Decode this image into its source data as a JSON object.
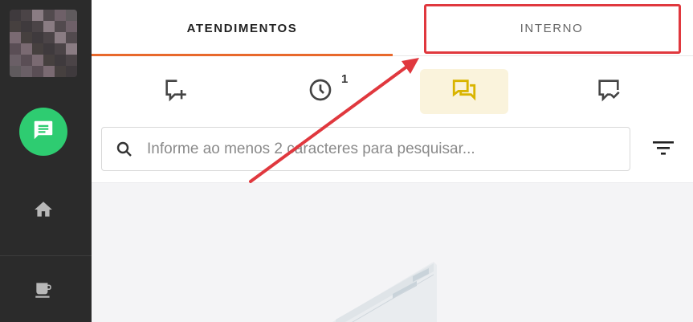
{
  "sidebar": {
    "items": [
      {
        "icon": "chat-icon",
        "color": "#2ecc71"
      },
      {
        "icon": "home-icon"
      },
      {
        "icon": "coffee-icon"
      }
    ]
  },
  "tabs": [
    {
      "label": "ATENDIMENTOS",
      "active": true
    },
    {
      "label": "INTERNO",
      "active": false
    }
  ],
  "toolbar": {
    "buttons": [
      {
        "icon": "new-chat-icon"
      },
      {
        "icon": "clock-icon",
        "badge": "1"
      },
      {
        "icon": "conversations-icon",
        "active": true
      },
      {
        "icon": "chat-done-icon"
      }
    ]
  },
  "search": {
    "placeholder": "Informe ao menos 2 caracteres para pesquisar..."
  },
  "colors": {
    "accent": "#e8692c",
    "highlight": "#e0383e",
    "active_icon": "#d9b400",
    "sidebar_bg": "#2b2b2b"
  }
}
